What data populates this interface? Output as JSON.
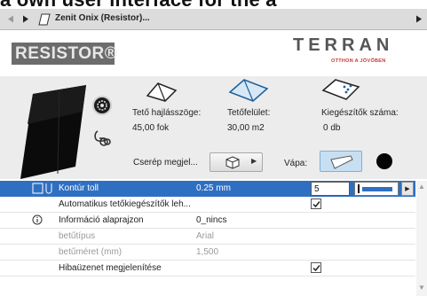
{
  "banner": {
    "partial_text": "a own user interface for the a"
  },
  "toolbar": {
    "back_icon": "triangle-left-icon",
    "forward_icon": "triangle-right-icon",
    "title": "Zenit Onix (Resistor)...",
    "end_icon": "triangle-right-icon"
  },
  "logos": {
    "left": "RESISTOR®",
    "right_brand": "TERRAN",
    "right_tagline": "OTTHON A JÖVŐBEN"
  },
  "properties": {
    "pitch_label": "Tető hajlásszöge:",
    "pitch_value": "45,00  fok",
    "area_label": "Tetőfelület:",
    "area_value": "30,00  m2",
    "accessories_label": "Kiegészítők száma:",
    "accessories_value": "0  db"
  },
  "controls": {
    "tile_display_label": "Cserép megjel...",
    "vapa_label": "Vápa:"
  },
  "table": {
    "rows": [
      {
        "label": "Kontúr toll",
        "value": "0.25 mm",
        "input_value": "5",
        "selected": true
      },
      {
        "label": "Automatikus tetőkiegészítők leh...",
        "checked": true
      },
      {
        "label": "Információ alaprajzon",
        "value": "0_nincs"
      },
      {
        "label": "betűtípus",
        "value": "Arial",
        "dimmed": true
      },
      {
        "label": "betűméret (mm)",
        "value": "1,500",
        "dimmed": true
      },
      {
        "label": "Hibaüzenet megjelenítése",
        "checked": true
      }
    ]
  },
  "colors": {
    "selection": "#2f6fc2",
    "panel": "#ececec",
    "toolbar": "#dcdcdc"
  }
}
